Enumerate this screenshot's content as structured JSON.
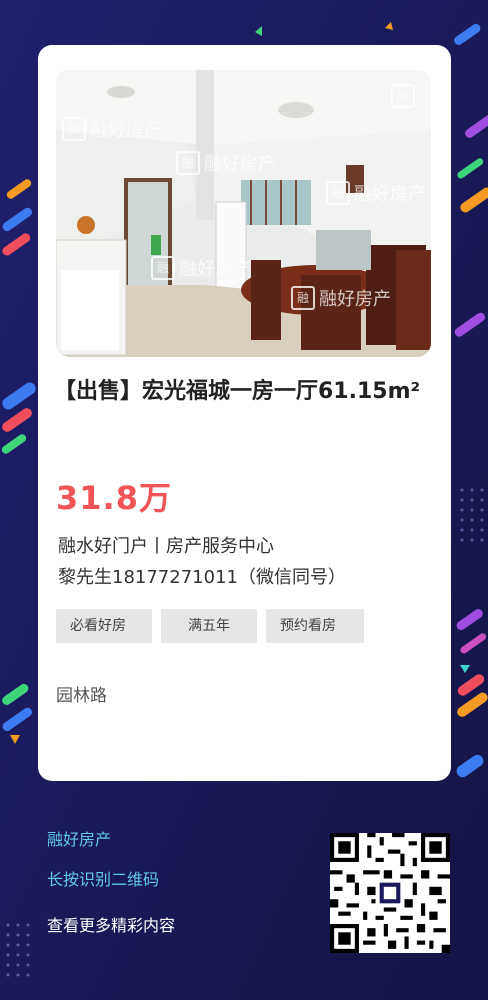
{
  "listing": {
    "title": "【出售】宏光福城一房一厅61.15m²",
    "price": "31.8万",
    "agency": "融水好门户丨房产服务中心",
    "contact": "黎先生18177271011（微信同号）",
    "tags": [
      "必看好房",
      "满五年",
      "预约看房"
    ],
    "location": "园林路"
  },
  "photo": {
    "watermark_text": "融好房产",
    "watermark_mark": "融"
  },
  "footer": {
    "brand": "融好房产",
    "scan_hint": "长按识别二维码",
    "more": "查看更多精彩内容"
  },
  "colors": {
    "background": "#1a1a5c",
    "card": "#ffffff",
    "price": "#f25555",
    "footer_accent": "#5fc8e8",
    "tag_bg": "#e6e6e6"
  }
}
